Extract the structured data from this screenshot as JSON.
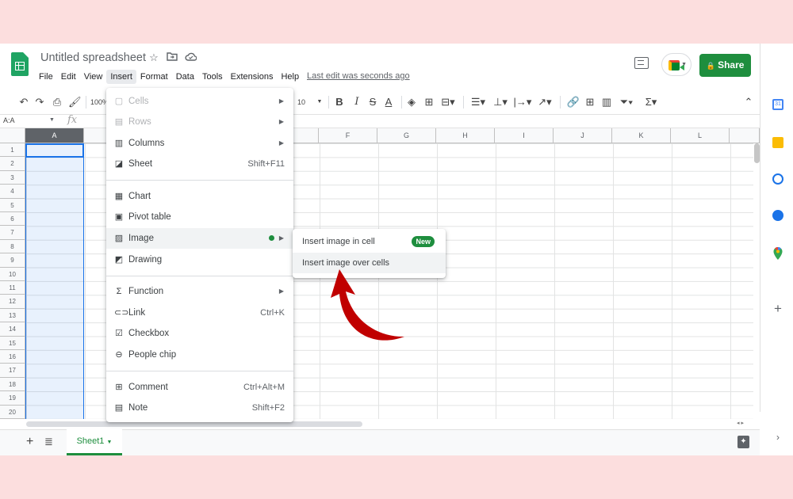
{
  "header": {
    "title": "Untitled spreadsheet",
    "menus": [
      "File",
      "Edit",
      "View",
      "Insert",
      "Format",
      "Data",
      "Tools",
      "Extensions",
      "Help"
    ],
    "last_edit": "Last edit was seconds ago",
    "share_label": "Share"
  },
  "toolbar": {
    "zoom": "100%",
    "font_size": "10"
  },
  "formula_bar": {
    "name_box": "A:A",
    "fx": "fx"
  },
  "grid": {
    "columns": [
      "A",
      "F",
      "G",
      "H",
      "I",
      "J",
      "K",
      "L"
    ],
    "rows": [
      "1",
      "2",
      "3",
      "4",
      "5",
      "6",
      "7",
      "8",
      "9",
      "10",
      "11",
      "12",
      "13",
      "14",
      "15",
      "16",
      "17",
      "18",
      "19",
      "20"
    ]
  },
  "insert_menu": {
    "items": [
      {
        "label": "Cells",
        "icon": "cells-icon",
        "submenu": true,
        "disabled": true
      },
      {
        "label": "Rows",
        "icon": "rows-icon",
        "submenu": true,
        "disabled": true
      },
      {
        "label": "Columns",
        "icon": "columns-icon",
        "submenu": true
      },
      {
        "label": "Sheet",
        "icon": "sheet-icon",
        "shortcut": "Shift+F11"
      },
      {
        "label": "Chart",
        "icon": "chart-icon"
      },
      {
        "label": "Pivot table",
        "icon": "pivot-table-icon"
      },
      {
        "label": "Image",
        "icon": "image-icon",
        "submenu": true
      },
      {
        "label": "Drawing",
        "icon": "drawing-icon"
      },
      {
        "label": "Function",
        "icon": "sigma-icon",
        "submenu": true
      },
      {
        "label": "Link",
        "icon": "link-icon",
        "shortcut": "Ctrl+K"
      },
      {
        "label": "Checkbox",
        "icon": "checkbox-icon"
      },
      {
        "label": "People chip",
        "icon": "person-icon"
      },
      {
        "label": "Comment",
        "icon": "comment-icon",
        "shortcut": "Ctrl+Alt+M"
      },
      {
        "label": "Note",
        "icon": "note-icon",
        "shortcut": "Shift+F2"
      }
    ]
  },
  "image_submenu": {
    "items": [
      {
        "label": "Insert image in cell",
        "badge": "New"
      },
      {
        "label": "Insert image over cells"
      }
    ]
  },
  "bottom": {
    "sheet_tab": "Sheet1"
  },
  "colors": {
    "accent": "#1e8e3e",
    "selection": "#1a73e8",
    "arrow": "#c00000",
    "background": "#fcdede"
  }
}
